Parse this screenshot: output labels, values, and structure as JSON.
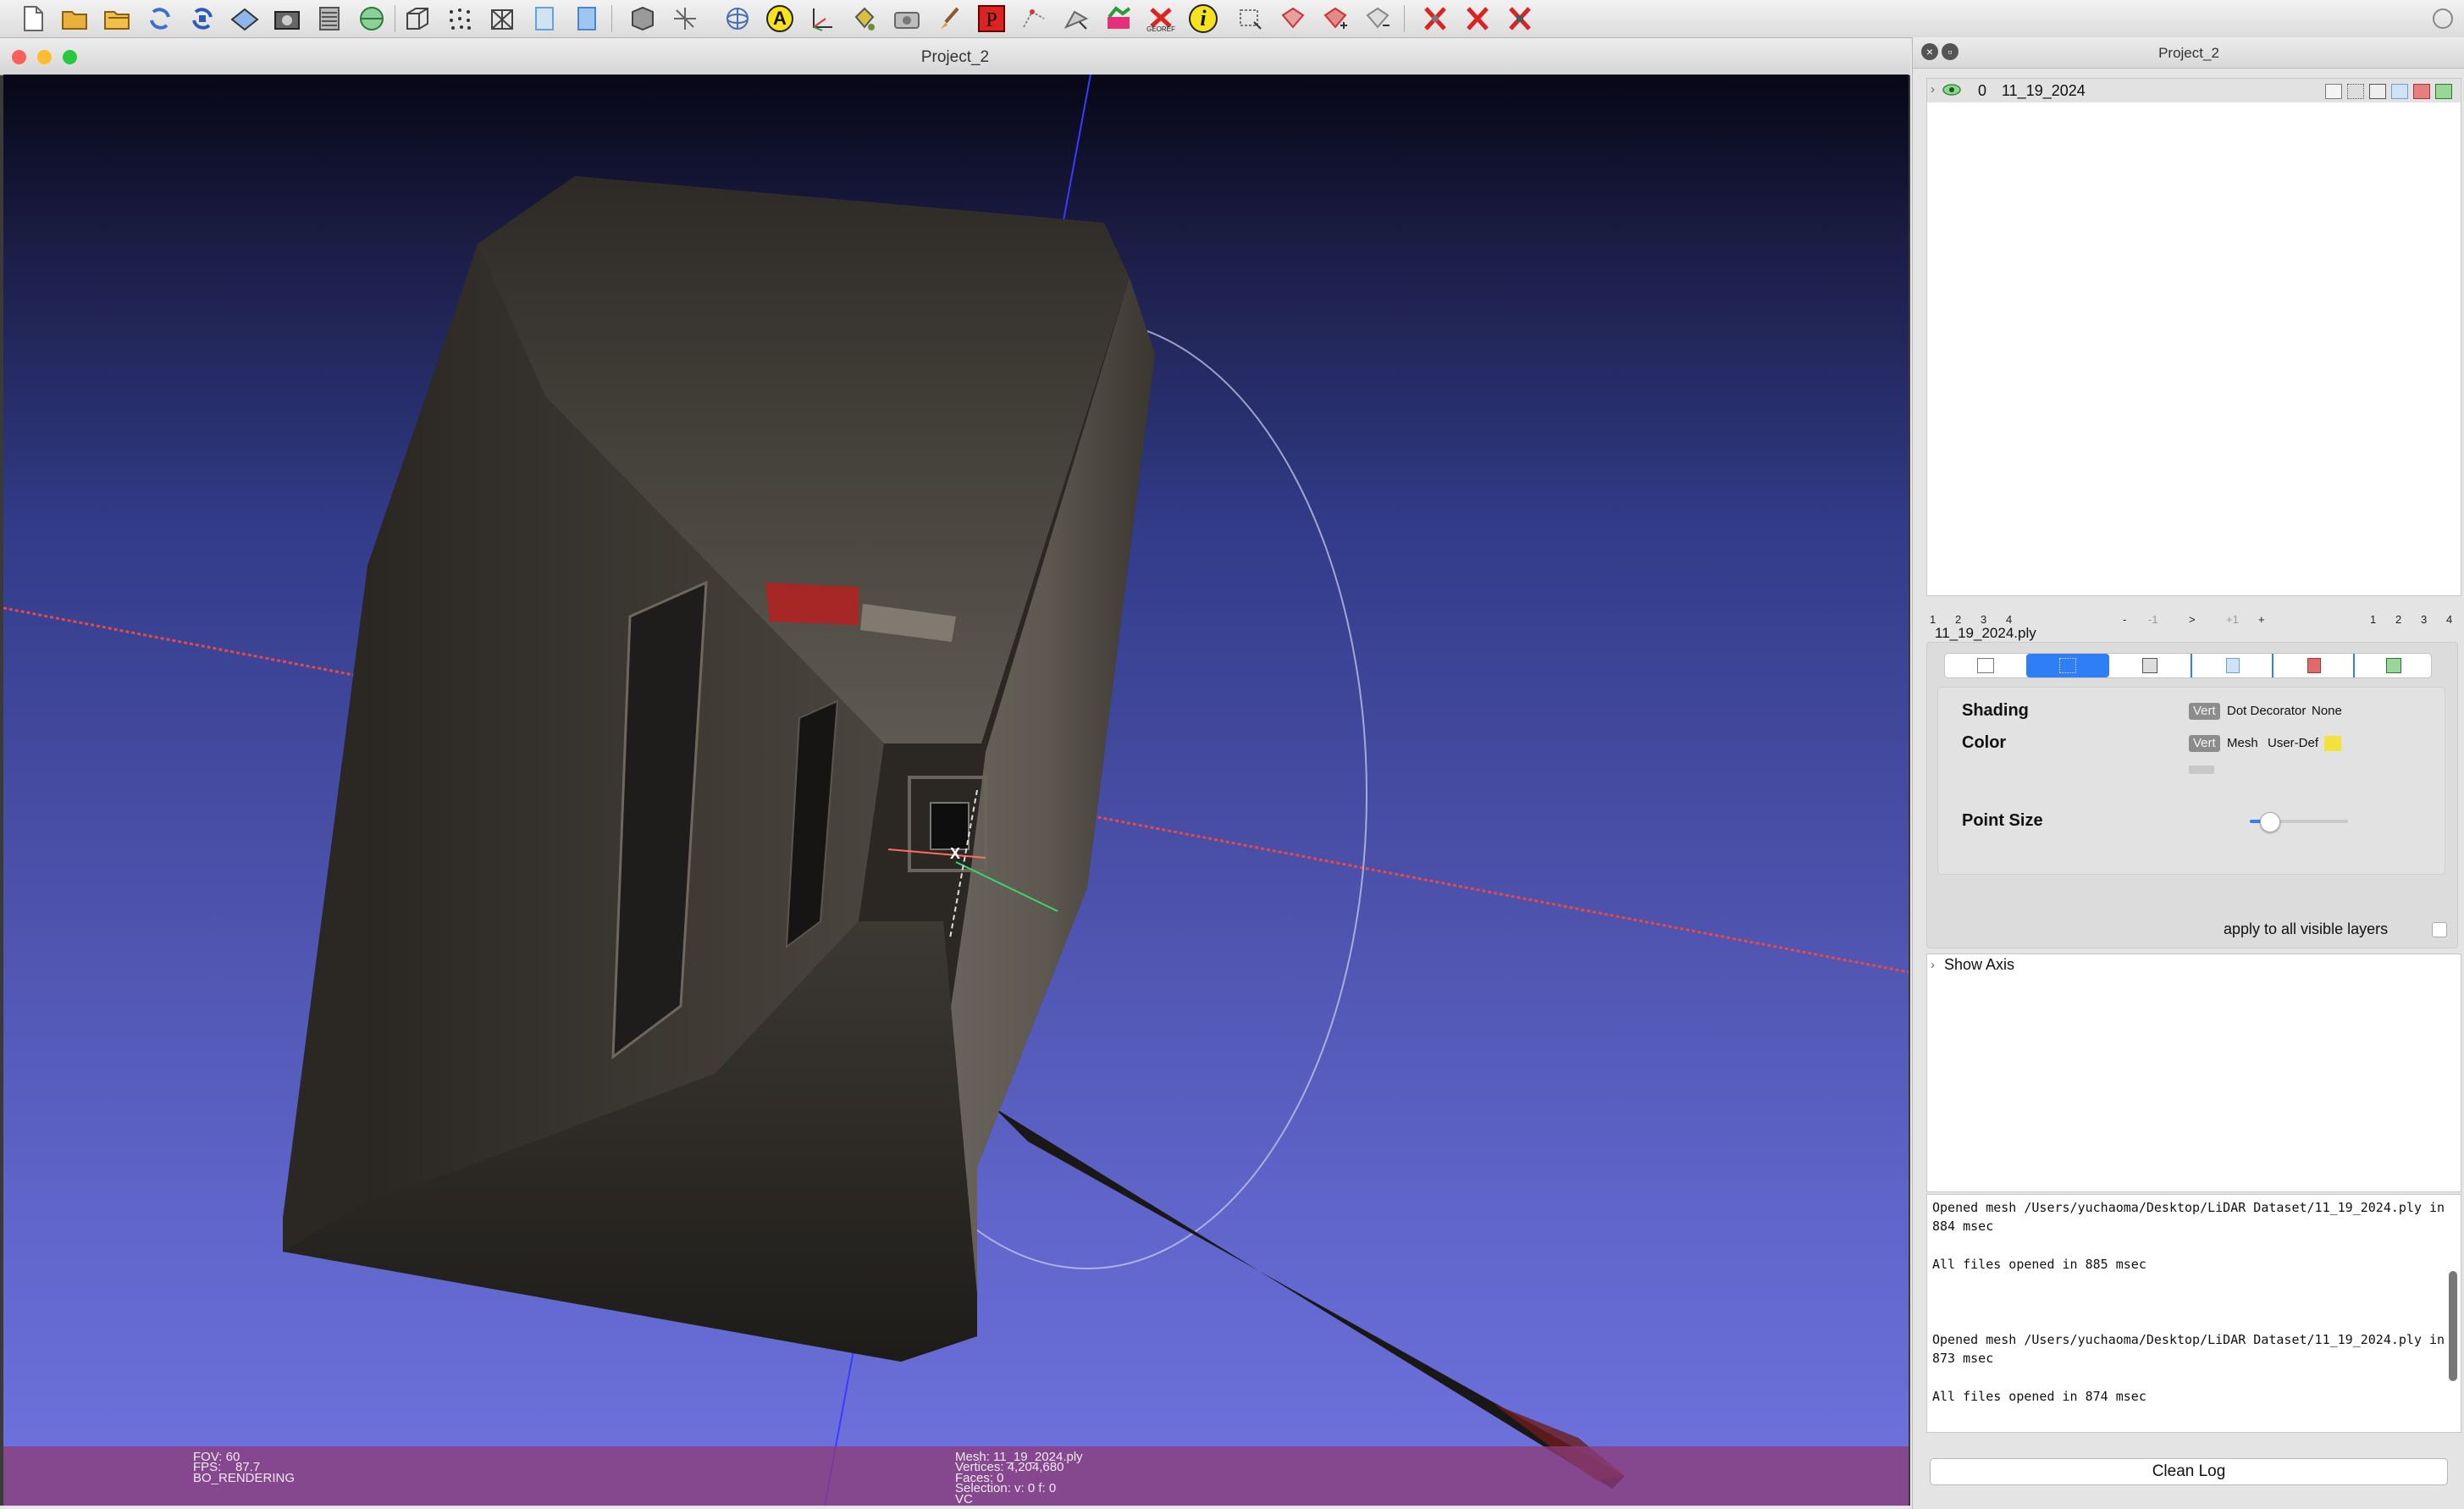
{
  "toolbar": {
    "icons": [
      "new-document-icon",
      "open-folder-icon",
      "open-project-icon",
      "reload-icon",
      "reload-all-icon",
      "save-icon",
      "snapshot-icon",
      "layers-icon",
      "globe-icon",
      "bounding-box-icon",
      "points-icon",
      "wireframe-icon",
      "flat-shading-icon",
      "smooth-shading-icon",
      "texture-icon",
      "axis-icon",
      "trackball-icon",
      "annotation-icon",
      "measure-axis-icon",
      "paint-bucket-icon",
      "camera-icon",
      "brush-icon",
      "p-tool-icon",
      "select-vertices-icon",
      "select-faces-icon",
      "paint-icon",
      "georef-icon",
      "info-icon",
      "select-region-icon",
      "cut-icon",
      "cut-plus-icon",
      "cut-minus-icon",
      "delete-faces-icon",
      "delete-vertices-icon",
      "delete-all-icon"
    ],
    "annotation_glyph": "A",
    "info_glyph": "i",
    "georef_text": "GEOREF"
  },
  "main_window": {
    "title": "Project_2"
  },
  "viewport": {
    "axis_label": "X",
    "info_left": {
      "fov": "FOV: 60",
      "fps": "FPS:    87.7",
      "mode": "BO_RENDERING"
    },
    "info_center": {
      "mesh": "Mesh: 11_19_2024.ply",
      "vertices": "Vertices: 4,204,680",
      "faces": "Faces: 0",
      "selection": "Selection: v: 0 f: 0",
      "vc": "VC"
    }
  },
  "right_panel": {
    "title": "Project_2",
    "layer": {
      "index": "0",
      "name": "11_19_2024"
    },
    "nav_left": [
      "1",
      "2",
      "3",
      "4"
    ],
    "nav_center": [
      "-",
      "-1",
      ">",
      "+1",
      "+"
    ],
    "nav_right": [
      "1",
      "2",
      "3",
      "4"
    ],
    "file_label": "11_19_2024.ply",
    "render": {
      "shading_label": "Shading",
      "shading_options": [
        "Vert",
        "Dot Decorator",
        "None"
      ],
      "color_label": "Color",
      "color_options": [
        "Vert",
        "Mesh",
        "User-Def"
      ],
      "user_color": "#f3e23a",
      "point_size_label": "Point Size",
      "point_size_fraction": 0.2,
      "apply_label": "apply to all visible layers"
    },
    "show_axis_label": "Show Axis",
    "log_lines": [
      "Opened mesh /Users/yuchaoma/Desktop/LiDAR Dataset/11_19_2024.ply in",
      "884 msec",
      "",
      "All files opened in 885 msec",
      "",
      "",
      "",
      "Opened mesh /Users/yuchaoma/Desktop/LiDAR Dataset/11_19_2024.ply in",
      "873 msec",
      "",
      "All files opened in 874 msec"
    ],
    "clean_log_label": "Clean Log"
  }
}
